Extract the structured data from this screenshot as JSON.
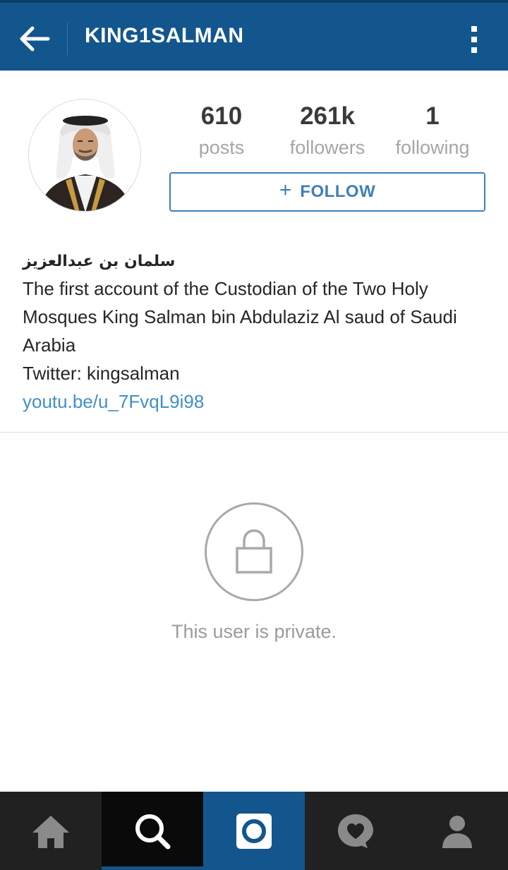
{
  "header": {
    "username": "KING1SALMAN"
  },
  "profile": {
    "stats": [
      {
        "value": "610",
        "label": "posts"
      },
      {
        "value": "261k",
        "label": "followers"
      },
      {
        "value": "1",
        "label": "following"
      }
    ],
    "follow_button": {
      "icon": "plus-icon",
      "label": "FOLLOW"
    }
  },
  "bio": {
    "full_name": "سلمان بن عبدالعزيز",
    "description": "The first account of the Custodian of the Two Holy Mosques King Salman bin Abdulaziz Al saud of Saudi Arabia",
    "twitter": "Twitter: kingsalman",
    "link": "youtu.be/u_7FvqL9i98"
  },
  "private_notice": {
    "icon": "lock-icon",
    "text": "This user is private."
  },
  "bottom_nav": {
    "items": [
      {
        "icon": "home-icon",
        "active": false
      },
      {
        "icon": "search-icon",
        "active": true
      },
      {
        "icon": "camera-icon",
        "active": false
      },
      {
        "icon": "activity-heart-icon",
        "active": false
      },
      {
        "icon": "profile-icon",
        "active": false
      }
    ]
  },
  "colors": {
    "brand": "#12568d",
    "accent": "#3f7fba",
    "link": "#3f8fc9"
  }
}
